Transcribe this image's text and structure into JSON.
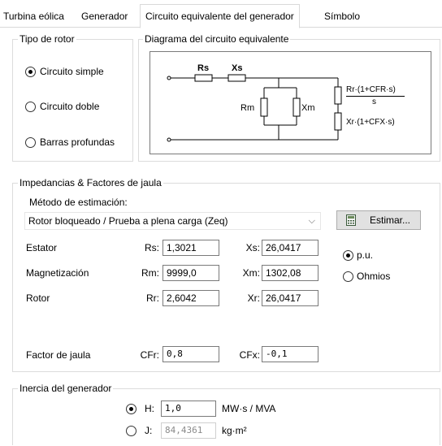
{
  "tabs": [
    {
      "label": "Turbina eólica"
    },
    {
      "label": "Generador"
    },
    {
      "label": "Circuito equivalente del generador"
    },
    {
      "label": "Símbolo"
    }
  ],
  "rotor_type": {
    "legend": "Tipo de rotor",
    "options": [
      {
        "label": "Circuito simple",
        "selected": true
      },
      {
        "label": "Circuito doble",
        "selected": false
      },
      {
        "label": "Barras profundas",
        "selected": false
      }
    ]
  },
  "diagram": {
    "legend": "Diagrama del circuito equivalente",
    "labels": {
      "rs": "Rs",
      "xs": "Xs",
      "rm": "Rm",
      "xm": "Xm",
      "rr_num": "Rr·(1+CFR·s)",
      "rr_den": "s",
      "xr": "Xr·(1+CFX·s)"
    }
  },
  "impedances": {
    "legend": "Impedancias & Factores de jaula",
    "method_label": "Método de estimación:",
    "method_value": "Rotor bloqueado / Prueba a plena carga (Zeq)",
    "estimate_button": "Estimar...",
    "rows": [
      {
        "name": "Estator",
        "p1_label": "Rs:",
        "p1_value": "1,3021",
        "p2_label": "Xs:",
        "p2_value": "26,0417"
      },
      {
        "name": "Magnetización",
        "p1_label": "Rm:",
        "p1_value": "9999,0",
        "p2_label": "Xm:",
        "p2_value": "1302,08"
      },
      {
        "name": "Rotor",
        "p1_label": "Rr:",
        "p1_value": "2,6042",
        "p2_label": "Xr:",
        "p2_value": "26,0417"
      }
    ],
    "cage": {
      "name": "Factor de jaula",
      "cfr_label": "CFr:",
      "cfr_value": "0,8",
      "cfx_label": "CFx:",
      "cfx_value": "-0,1"
    },
    "units": [
      {
        "label": "p.u.",
        "selected": true
      },
      {
        "label": "Ohmios",
        "selected": false
      }
    ]
  },
  "inertia": {
    "legend": "Inercia del generador",
    "h": {
      "label": "H:",
      "value": "1,0",
      "unit": "MW·s / MVA",
      "selected": true
    },
    "j": {
      "label": "J:",
      "value": "84,4361",
      "unit": "kg·m²",
      "selected": false
    }
  }
}
